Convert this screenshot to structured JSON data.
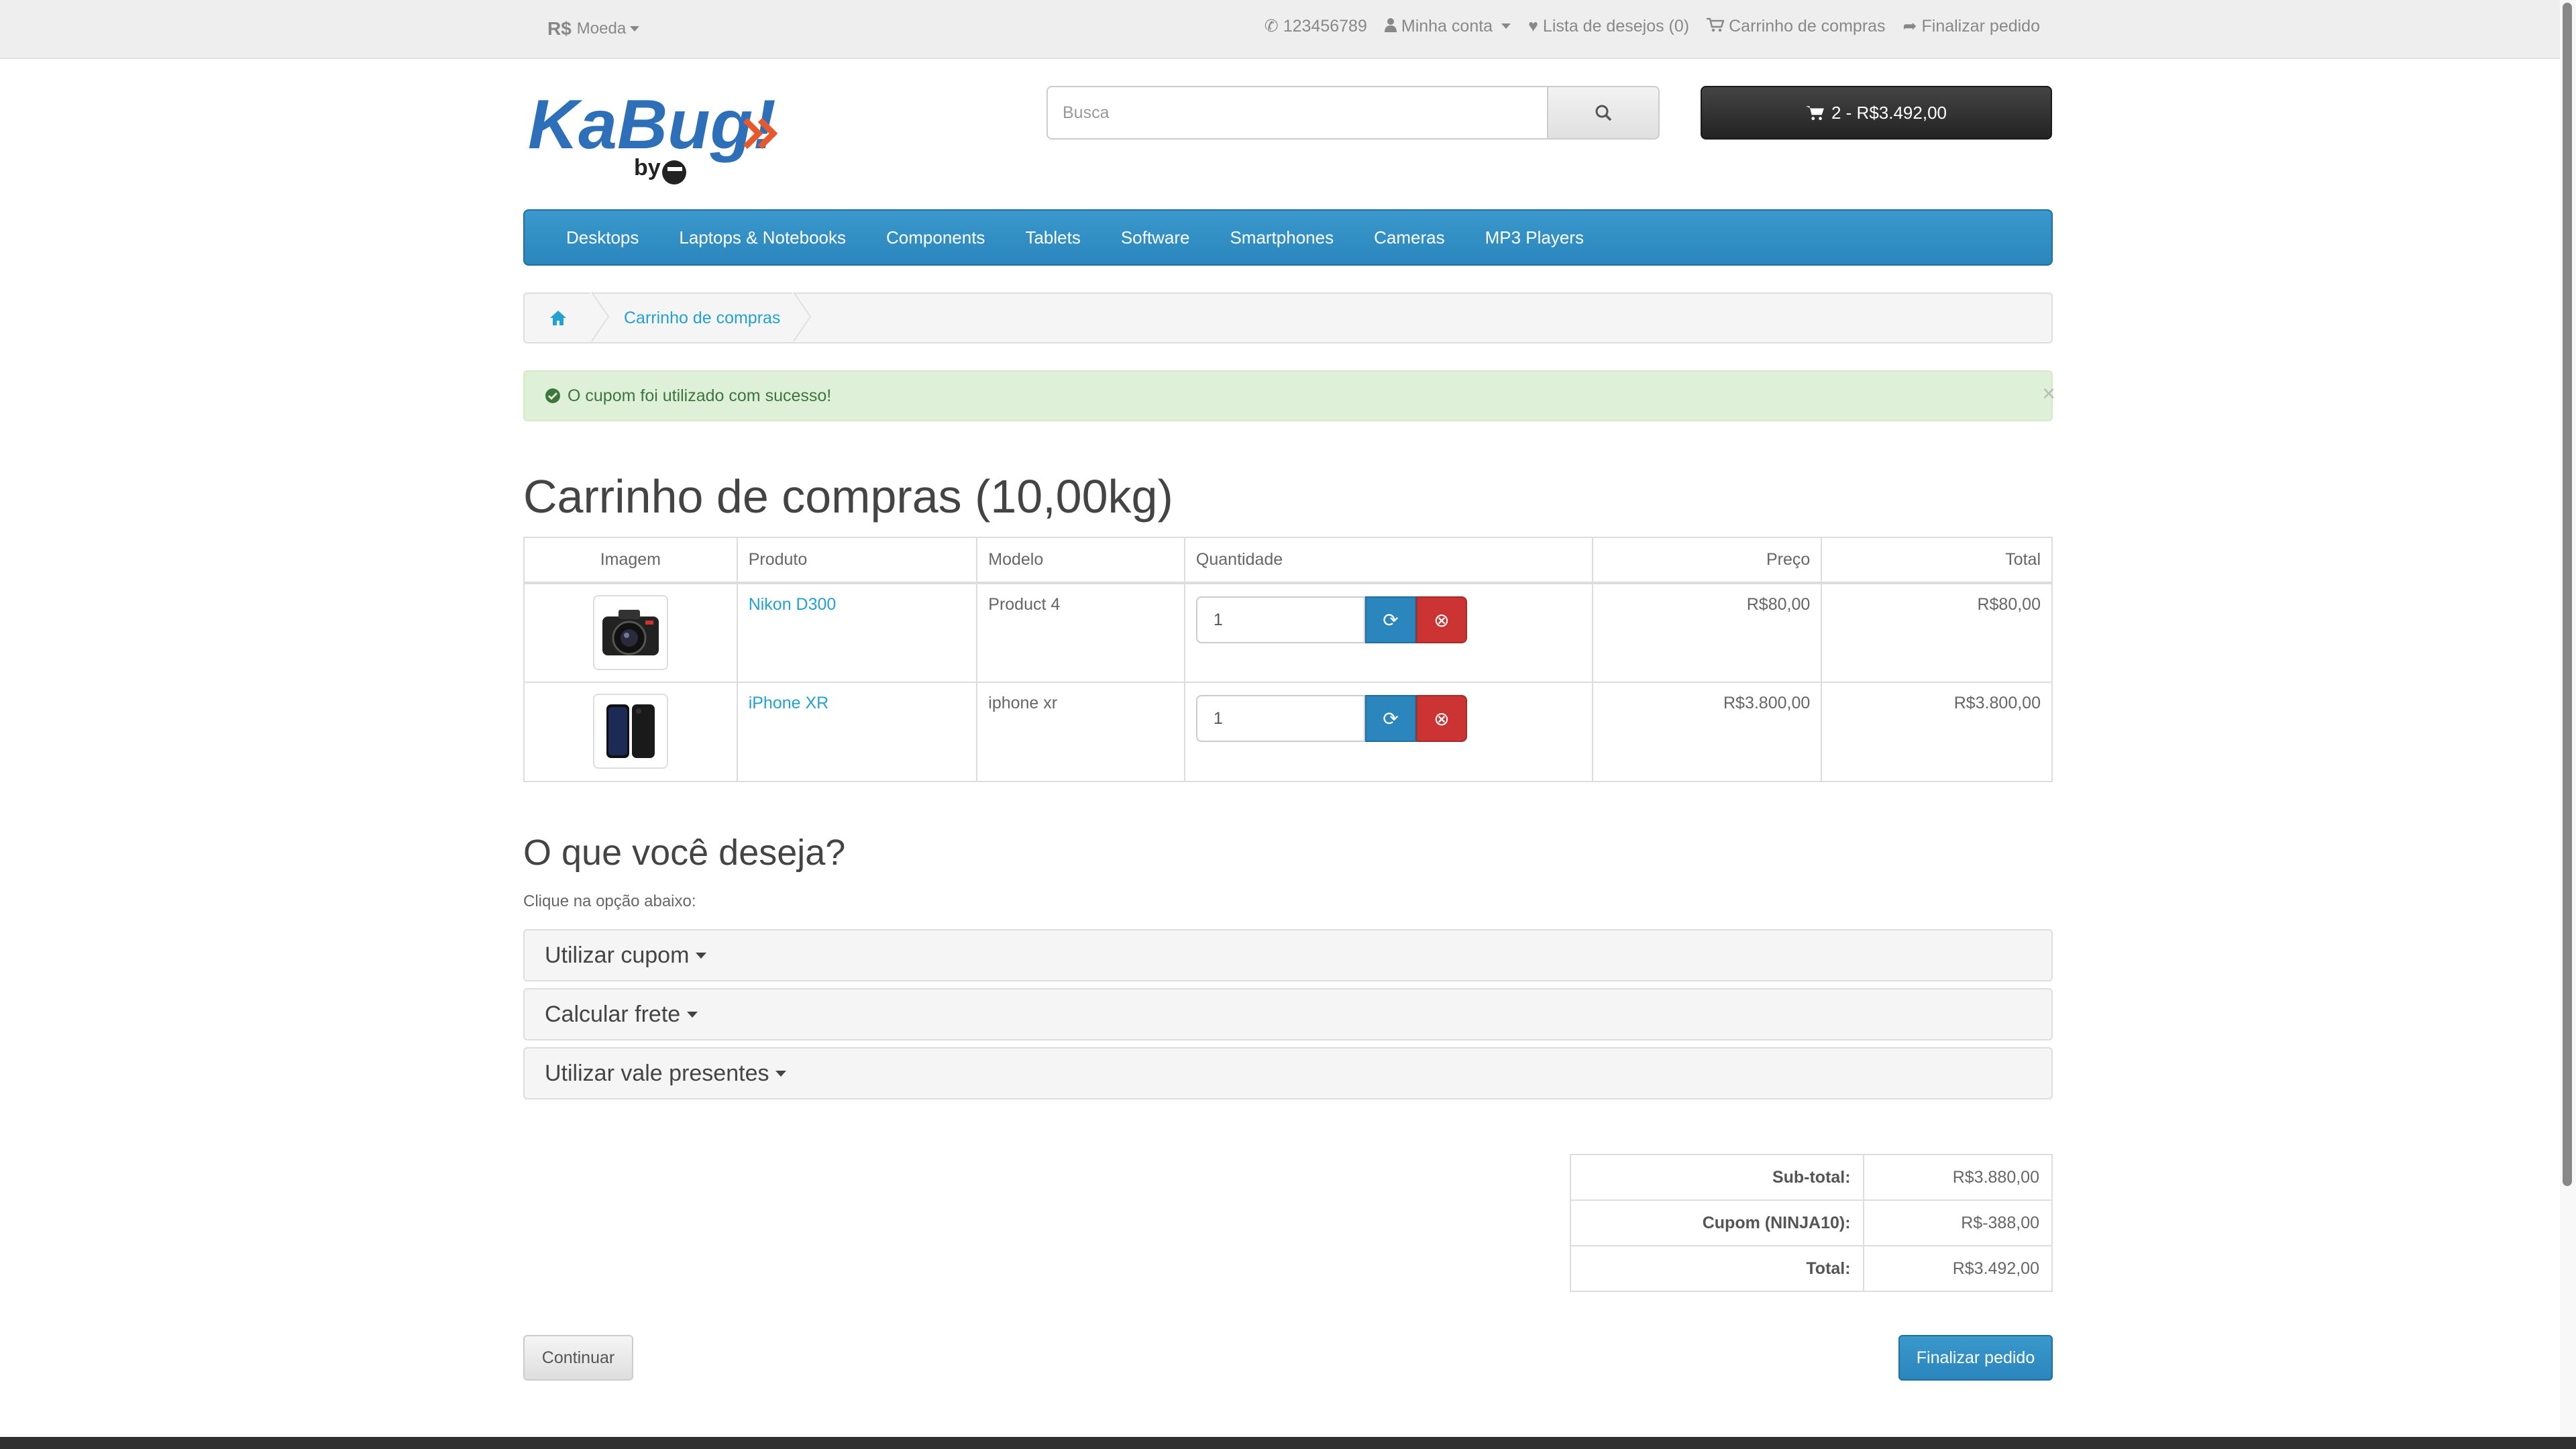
{
  "topbar": {
    "currency_symbol": "R$",
    "currency_label": "Moeda",
    "phone": "123456789",
    "account": "Minha conta",
    "wishlist": "Lista de desejos (0)",
    "cart": "Carrinho de compras",
    "checkout": "Finalizar pedido"
  },
  "header": {
    "logo_text": "KaBug!",
    "logo_sub": "by",
    "search_placeholder": "Busca",
    "cart_summary": "2 - R$3.492,00"
  },
  "nav": {
    "items": [
      "Desktops",
      "Laptops & Notebooks",
      "Components",
      "Tablets",
      "Software",
      "Smartphones",
      "Cameras",
      "MP3 Players"
    ]
  },
  "breadcrumb": {
    "current": "Carrinho de compras"
  },
  "alert": {
    "message": "O cupom foi utilizado com sucesso!",
    "close": "×"
  },
  "page": {
    "title": "Carrinho de compras  (10,00kg)"
  },
  "cart_table": {
    "headers": {
      "image": "Imagem",
      "product": "Produto",
      "model": "Modelo",
      "quantity": "Quantidade",
      "price": "Preço",
      "total": "Total"
    },
    "rows": [
      {
        "product": "Nikon D300",
        "model": "Product 4",
        "quantity": "1",
        "price": "R$80,00",
        "total": "R$80,00",
        "image_icon": "camera-thumbnail"
      },
      {
        "product": "iPhone XR",
        "model": "iphone xr",
        "quantity": "1",
        "price": "R$3.800,00",
        "total": "R$3.800,00",
        "image_icon": "phone-thumbnail"
      }
    ]
  },
  "options": {
    "heading": "O que você deseja?",
    "hint": "Clique na opção abaixo:",
    "panels": [
      "Utilizar cupom",
      "Calcular frete",
      "Utilizar vale presentes"
    ]
  },
  "totals": {
    "rows": [
      {
        "label": "Sub-total:",
        "value": "R$3.880,00"
      },
      {
        "label": "Cupom (NINJA10):",
        "value": "R$-388,00"
      },
      {
        "label": "Total:",
        "value": "R$3.492,00"
      }
    ]
  },
  "actions": {
    "continue": "Continuar",
    "checkout": "Finalizar pedido"
  },
  "colors": {
    "primary": "#2a86bc",
    "danger": "#cc3333",
    "link": "#23a1d1",
    "success_bg": "#dff0d8",
    "logo_blue": "#2d6fb8",
    "logo_orange": "#e8582a"
  }
}
